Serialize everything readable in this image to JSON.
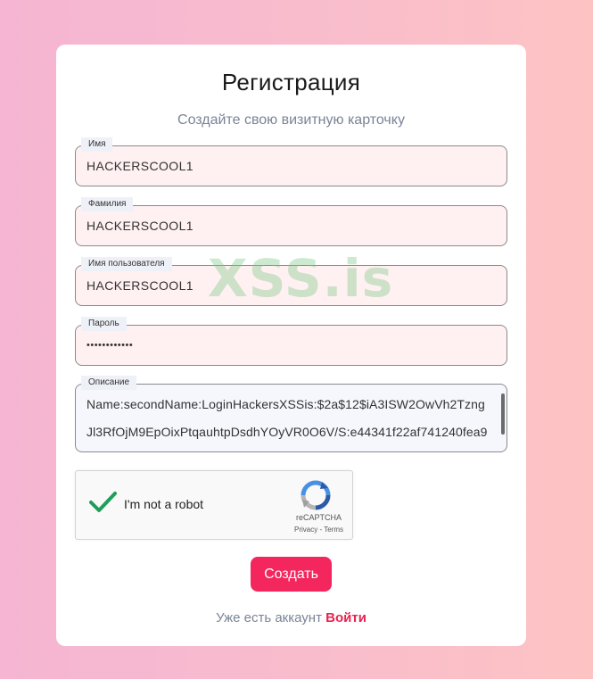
{
  "form": {
    "title": "Регистрация",
    "subtitle": "Создайте свою визитную карточку",
    "fields": [
      {
        "label": "Имя",
        "value": "HACKERSCOOL1"
      },
      {
        "label": "Фамилия",
        "value": "HACKERSCOOL1"
      },
      {
        "label": "Имя пользователя",
        "value": "HACKERSCOOL1"
      },
      {
        "label": "Пароль",
        "value": "••••••••••••"
      }
    ],
    "description": {
      "label": "Описание",
      "lines": [
        "Name:secondName:LoginHackersXSSis:$2a$12$iA3ISW2OwVh2Tzng",
        "Jl3RfOjM9EpOixPtqauhtpDsdhYOyVR0O6V/S:e44341f22af741240fea9"
      ]
    },
    "captcha": {
      "text": "I'm not a robot",
      "brand": "reCAPTCHA",
      "links": "Privacy - Terms",
      "checked": true
    },
    "submit_label": "Создать",
    "login_prompt": "Уже есть аккаунт",
    "login_link": "Войти"
  },
  "watermark": "XSS.is",
  "colors": {
    "accent": "#f3265d",
    "link": "#e8234f",
    "field_bg": "#fff0f2",
    "check": "#1e9e5a"
  }
}
